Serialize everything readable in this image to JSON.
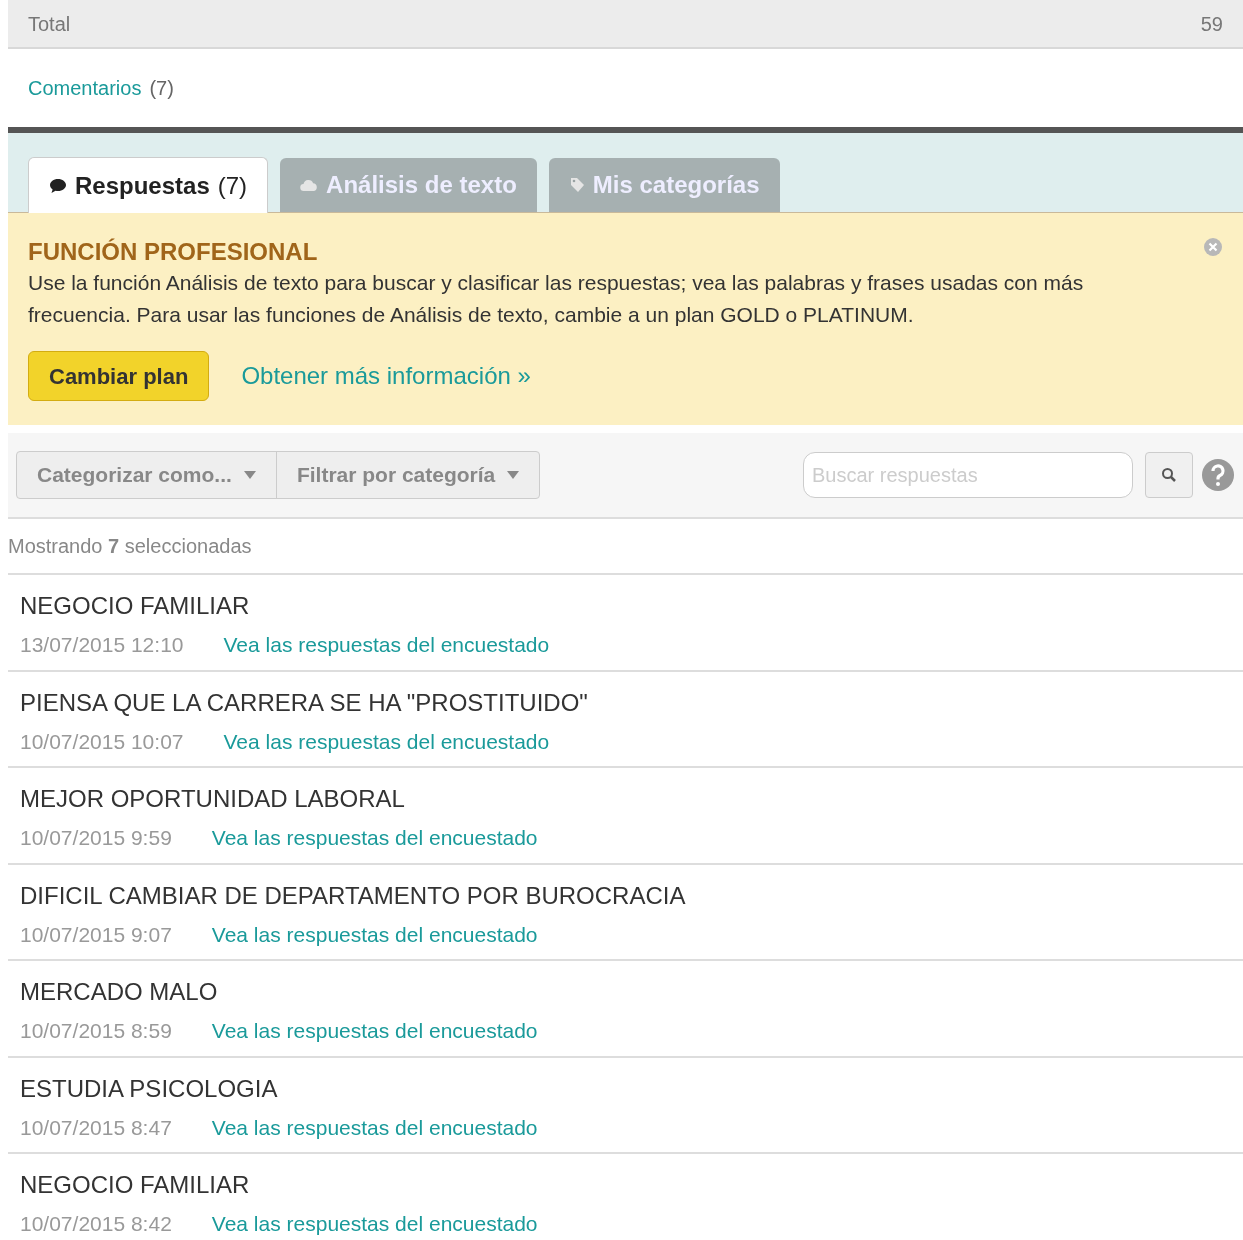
{
  "total_row": {
    "label": "Total",
    "value": "59"
  },
  "comments_link": {
    "label": "Comentarios",
    "count": "(7)"
  },
  "tabs": [
    {
      "label": "Respuestas",
      "count": "(7)",
      "selected": true,
      "kind": "comment"
    },
    {
      "label": "Análisis de texto",
      "selected": false,
      "kind": "cloud"
    },
    {
      "label": "Mis categorías",
      "selected": false,
      "kind": "tag"
    }
  ],
  "notice": {
    "title": "FUNCIÓN PROFESIONAL",
    "text": "Use la función Análisis de texto para buscar y clasificar las respuestas; vea las palabras y frases usadas con más frecuencia. Para usar las funciones de Análisis de texto, cambie a un plan GOLD o PLATINUM.",
    "button": "Cambiar plan",
    "link": "Obtener más información »"
  },
  "toolbar": {
    "dropdowns": [
      "Categorizar como...",
      "Filtrar por categoría"
    ],
    "search": {
      "placeholder": "Buscar respuestas"
    }
  },
  "showing": "Mostrando **7** seleccionadas",
  "responses": [
    {
      "text": "NEGOCIO FAMILIAR",
      "date": "13/07/2015 12:10",
      "link": "Vea las respuestas del encuestado"
    },
    {
      "text": "PIENSA QUE LA CARRERA SE HA \"PROSTITUIDO\"",
      "date": "10/07/2015 10:07",
      "link": "Vea las respuestas del encuestado"
    },
    {
      "text": "MEJOR OPORTUNIDAD LABORAL",
      "date": "10/07/2015 9:59",
      "link": "Vea las respuestas del encuestado"
    },
    {
      "text": "DIFICIL CAMBIAR DE DEPARTAMENTO POR BUROCRACIA",
      "date": "10/07/2015 9:07",
      "link": "Vea las respuestas del encuestado"
    },
    {
      "text": "MERCADO MALO",
      "date": "10/07/2015 8:59",
      "link": "Vea las respuestas del encuestado"
    },
    {
      "text": "ESTUDIA PSICOLOGIA",
      "date": "10/07/2015 8:47",
      "link": "Vea las respuestas del encuestado"
    },
    {
      "text": "NEGOCIO FAMILIAR",
      "date": "10/07/2015 8:42",
      "link": "Vea las respuestas del encuestado"
    }
  ]
}
